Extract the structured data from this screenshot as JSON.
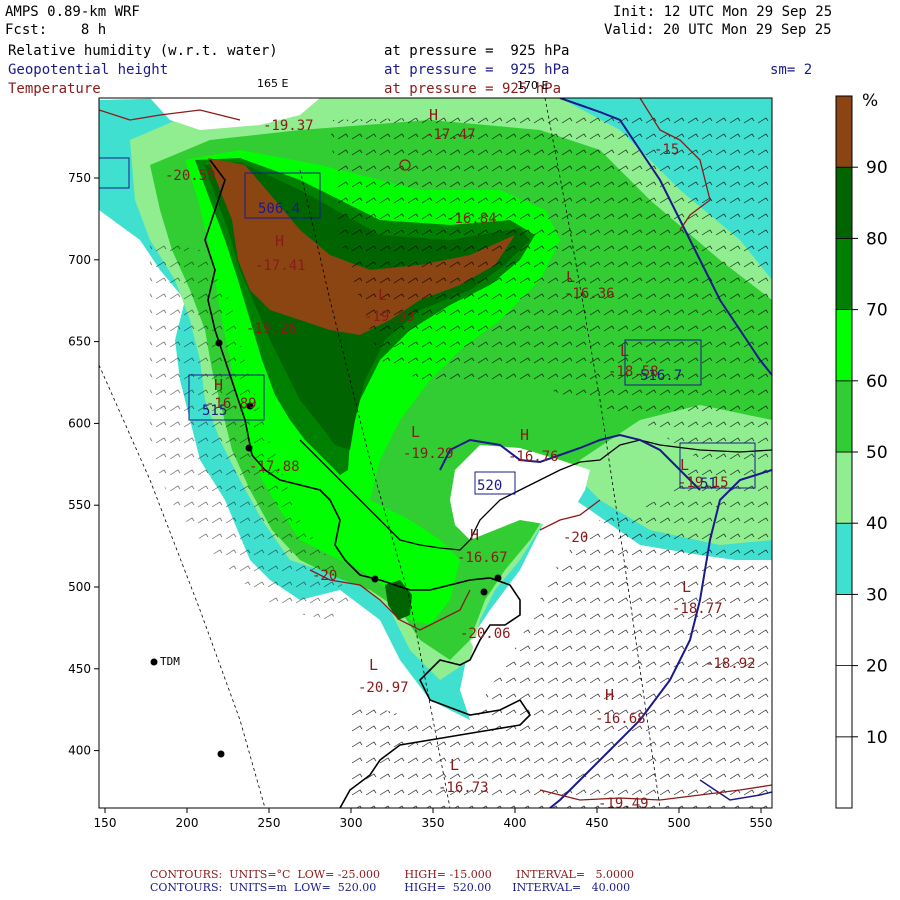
{
  "header": {
    "model": "AMPS 0.89-km WRF",
    "forecast": "Fcst:    8 h",
    "init": "Init: 12 UTC Mon 29 Sep 25",
    "valid": "Valid: 20 UTC Mon 29 Sep 25",
    "field1_name": "Relative humidity (w.r.t. water)",
    "field1_level": "at pressure =  925 hPa",
    "field2_name": "Geopotential height",
    "field2_level": "at pressure =  925 hPa",
    "field3_name": "Temperature",
    "field3_level": "at pressure = 925 hPa",
    "smoothing": "sm= 2",
    "lon_label_165e": "165 E",
    "lon_label_170e": "170 E"
  },
  "colorbar": {
    "unit": "%",
    "levels": [
      "90",
      "80",
      "70",
      "60",
      "50",
      "40",
      "30",
      "20",
      "10"
    ],
    "colors": [
      "#8b4513",
      "#006400",
      "#008000",
      "#00ff00",
      "#32cd32",
      "#90ee90",
      "#40e0d0",
      "#ffffff",
      "#ffffff"
    ]
  },
  "axes": {
    "x_ticks": [
      "150",
      "200",
      "250",
      "300",
      "350",
      "400",
      "450",
      "500",
      "550"
    ],
    "y_ticks": [
      "750",
      "700",
      "650",
      "600",
      "550",
      "500",
      "450",
      "400"
    ]
  },
  "map_labels": {
    "stations": [
      {
        "name": "TDM"
      }
    ],
    "height_boxes": [
      "506.4",
      "515",
      "520",
      "516.7",
      "51"
    ],
    "temperature_labels": [
      "-17.47",
      "-20.59",
      "-19.37",
      "-16.84",
      "-17.41",
      "-19.03",
      "-16.36",
      "-19.26",
      "-18.58",
      "-16.89",
      "-17.88",
      "-19.29",
      "-16.76",
      "-19.15",
      "-20",
      "-20",
      "-16.67",
      "-18.77",
      "-20.06",
      "-18.92",
      "-20.97",
      "-16.68",
      "-16.73",
      "-19.49",
      "-15"
    ],
    "hl_markers": [
      "H",
      "L",
      "H",
      "L",
      "L",
      "L",
      "H",
      "L",
      "H",
      "L",
      "L",
      "H",
      "L",
      "H"
    ]
  },
  "footer": {
    "temp_contours": "CONTOURS:  UNITS=°C  LOW= -25.000       HIGH= -15.000       INTERVAL=   5.0000",
    "height_contours": "CONTOURS:  UNITS=m  LOW=  520.00        HIGH=  520.00      INTERVAL=   40.000"
  },
  "colors": {
    "rh_30": "#40e0d0",
    "rh_40": "#90ee90",
    "rh_50": "#32cd32",
    "rh_60": "#00ff00",
    "rh_70": "#008000",
    "rh_80": "#006400",
    "rh_90": "#8b4513",
    "temperature": "#8b1a1a",
    "height": "#1a1a8c",
    "coastline": "#000000"
  }
}
